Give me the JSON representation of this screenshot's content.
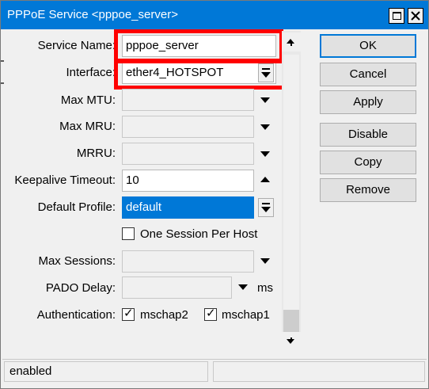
{
  "window": {
    "title": "PPPoE Service <pppoe_server>"
  },
  "form": {
    "service_name_label": "Service Name:",
    "service_name_value": "pppoe_server",
    "interface_label": "Interface:",
    "interface_value": "ether4_HOTSPOT",
    "max_mtu_label": "Max MTU:",
    "max_mtu_value": "",
    "max_mru_label": "Max MRU:",
    "max_mru_value": "",
    "mrru_label": "MRRU:",
    "mrru_value": "",
    "keepalive_label": "Keepalive Timeout:",
    "keepalive_value": "10",
    "default_profile_label": "Default Profile:",
    "default_profile_value": "default",
    "one_session_label": "One Session Per Host",
    "one_session_checked": false,
    "max_sessions_label": "Max Sessions:",
    "max_sessions_value": "",
    "pado_delay_label": "PADO Delay:",
    "pado_delay_value": "",
    "pado_delay_unit": "ms",
    "authentication_label": "Authentication:",
    "auth_options": [
      {
        "label": "mschap2",
        "checked": true
      },
      {
        "label": "mschap1",
        "checked": true
      }
    ]
  },
  "buttons": {
    "ok": "OK",
    "cancel": "Cancel",
    "apply": "Apply",
    "disable": "Disable",
    "copy": "Copy",
    "remove": "Remove"
  },
  "status": {
    "state": "enabled",
    "extra": ""
  },
  "colors": {
    "titlebar": "#0078d7",
    "highlight": "#ff0000",
    "selection": "#0078d7"
  },
  "icons": {
    "maximize": "maximize-icon",
    "close": "close-icon",
    "dropdown": "chevron-down-icon",
    "scroll_up": "scroll-up-icon",
    "scroll_down": "scroll-down-icon"
  }
}
